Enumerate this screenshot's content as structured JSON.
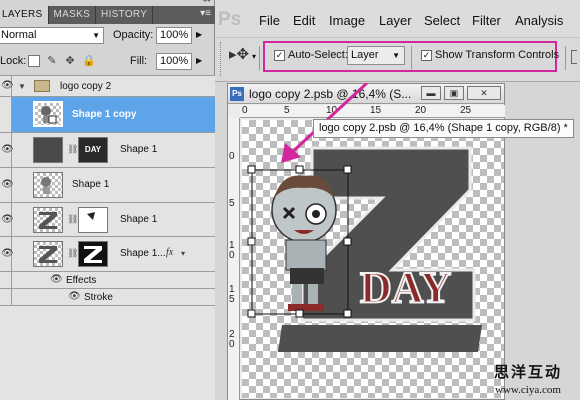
{
  "layers_panel": {
    "tabs": [
      {
        "label": "LAYERS",
        "active": true
      },
      {
        "label": "MASKS",
        "active": false
      },
      {
        "label": "HISTORY",
        "active": false
      }
    ],
    "blend_mode": "Normal",
    "opacity_label": "Opacity:",
    "opacity_value": "100%",
    "lock_label": "Lock:",
    "fill_label": "Fill:",
    "fill_value": "100%",
    "layers": [
      {
        "name": "logo copy 2",
        "kind": "group"
      },
      {
        "name": "Shape 1 copy",
        "kind": "shape",
        "selected": true
      },
      {
        "name": "Shape 1",
        "kind": "shape-mask",
        "mask_text": "DAY"
      },
      {
        "name": "Shape 1",
        "kind": "shape"
      },
      {
        "name": "Shape 1",
        "kind": "shape-mask"
      },
      {
        "name": "Shape 1...",
        "kind": "shape-mask-fx",
        "fx": "fx"
      }
    ],
    "effects_label": "Effects",
    "stroke_label": "Stroke"
  },
  "menubar": {
    "logo": "Ps",
    "items": [
      "File",
      "Edit",
      "Image",
      "Layer",
      "Select",
      "Filter",
      "Analysis"
    ]
  },
  "options_bar": {
    "auto_select_label": "Auto-Select:",
    "auto_select_checked": true,
    "auto_select_target": "Layer",
    "show_transform_label": "Show Transform Controls",
    "show_transform_checked": true,
    "highlight_color": "#d2279e"
  },
  "document": {
    "icon": "Ps",
    "title": "logo copy 2.psb @ 16,4% (S...",
    "ruler_h": [
      "0",
      "5",
      "10",
      "15",
      "20",
      "25"
    ],
    "ruler_v": [
      "0",
      "5",
      "1\n0",
      "1\n5",
      "2\n0"
    ],
    "tooltip": "logo copy 2.psb @ 16,4% (Shape 1 copy, RGB/8) *",
    "artwork_text": "DAY"
  },
  "watermark": {
    "chinese": "思洋互动",
    "url": "www.ciya.com"
  }
}
